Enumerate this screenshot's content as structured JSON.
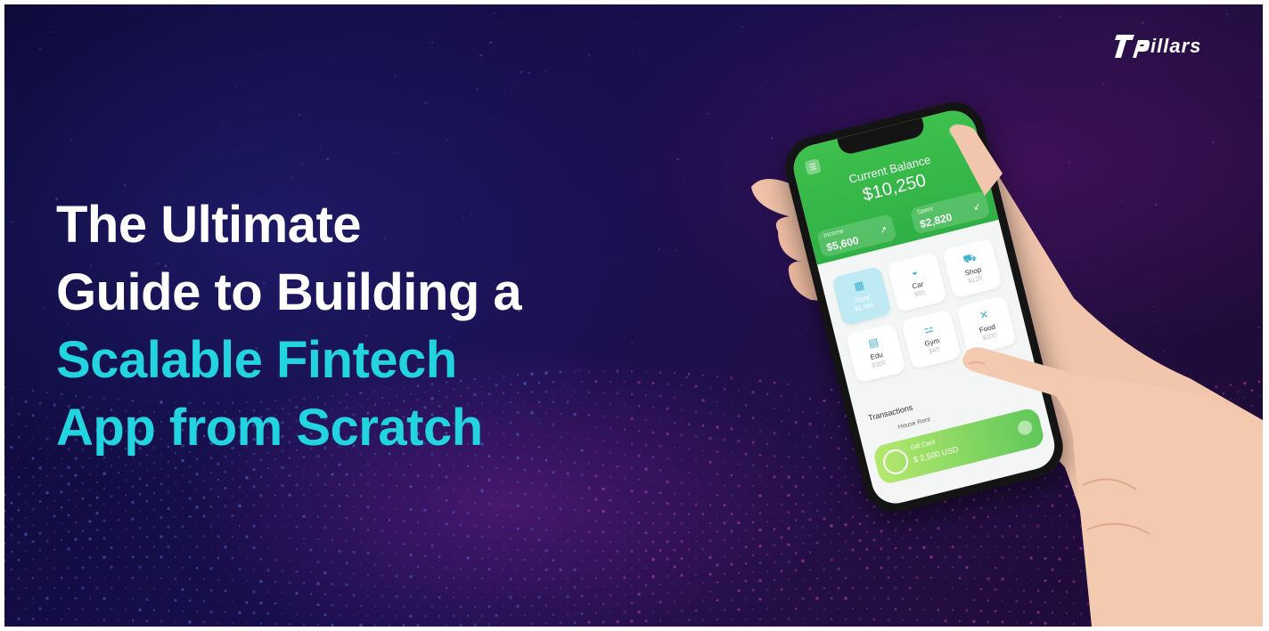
{
  "headline": {
    "line1": "The Ultimate",
    "line2": "Guide to Building a",
    "line3": "Scalable Fintech",
    "line4": "App from Scratch"
  },
  "logo": {
    "mark": "7P",
    "text": "illars"
  },
  "phone_app": {
    "balance_title": "Current Balance",
    "balance_value": "$10,250",
    "income_label": "Income",
    "income_value": "$5,600",
    "income_arrow": "↗",
    "spent_label": "Spent",
    "spent_value": "$2,820",
    "spent_arrow": "↙",
    "categories": [
      {
        "name": "Rent",
        "amount": "$1,000",
        "icon": "building-icon",
        "glyph": "▦"
      },
      {
        "name": "Car",
        "amount": "$80",
        "icon": "car-icon",
        "glyph": "◒"
      },
      {
        "name": "Shop",
        "amount": "$120",
        "icon": "cart-icon",
        "glyph": "⛟"
      },
      {
        "name": "Edu",
        "amount": "$300",
        "icon": "book-icon",
        "glyph": "▤"
      },
      {
        "name": "Gym",
        "amount": "$40",
        "icon": "dumbbell-icon",
        "glyph": "⚍"
      },
      {
        "name": "Food",
        "amount": "$200",
        "icon": "utensils-icon",
        "glyph": "✕"
      }
    ],
    "transactions_title": "Transactions",
    "transaction_row": "House Rent",
    "gift_card_label": "Gift Card",
    "gift_card_value": "$ 2,500 USD"
  },
  "colors": {
    "accent_cyan": "#21d4df",
    "app_green": "#3ec04d",
    "background": "#150e45"
  }
}
